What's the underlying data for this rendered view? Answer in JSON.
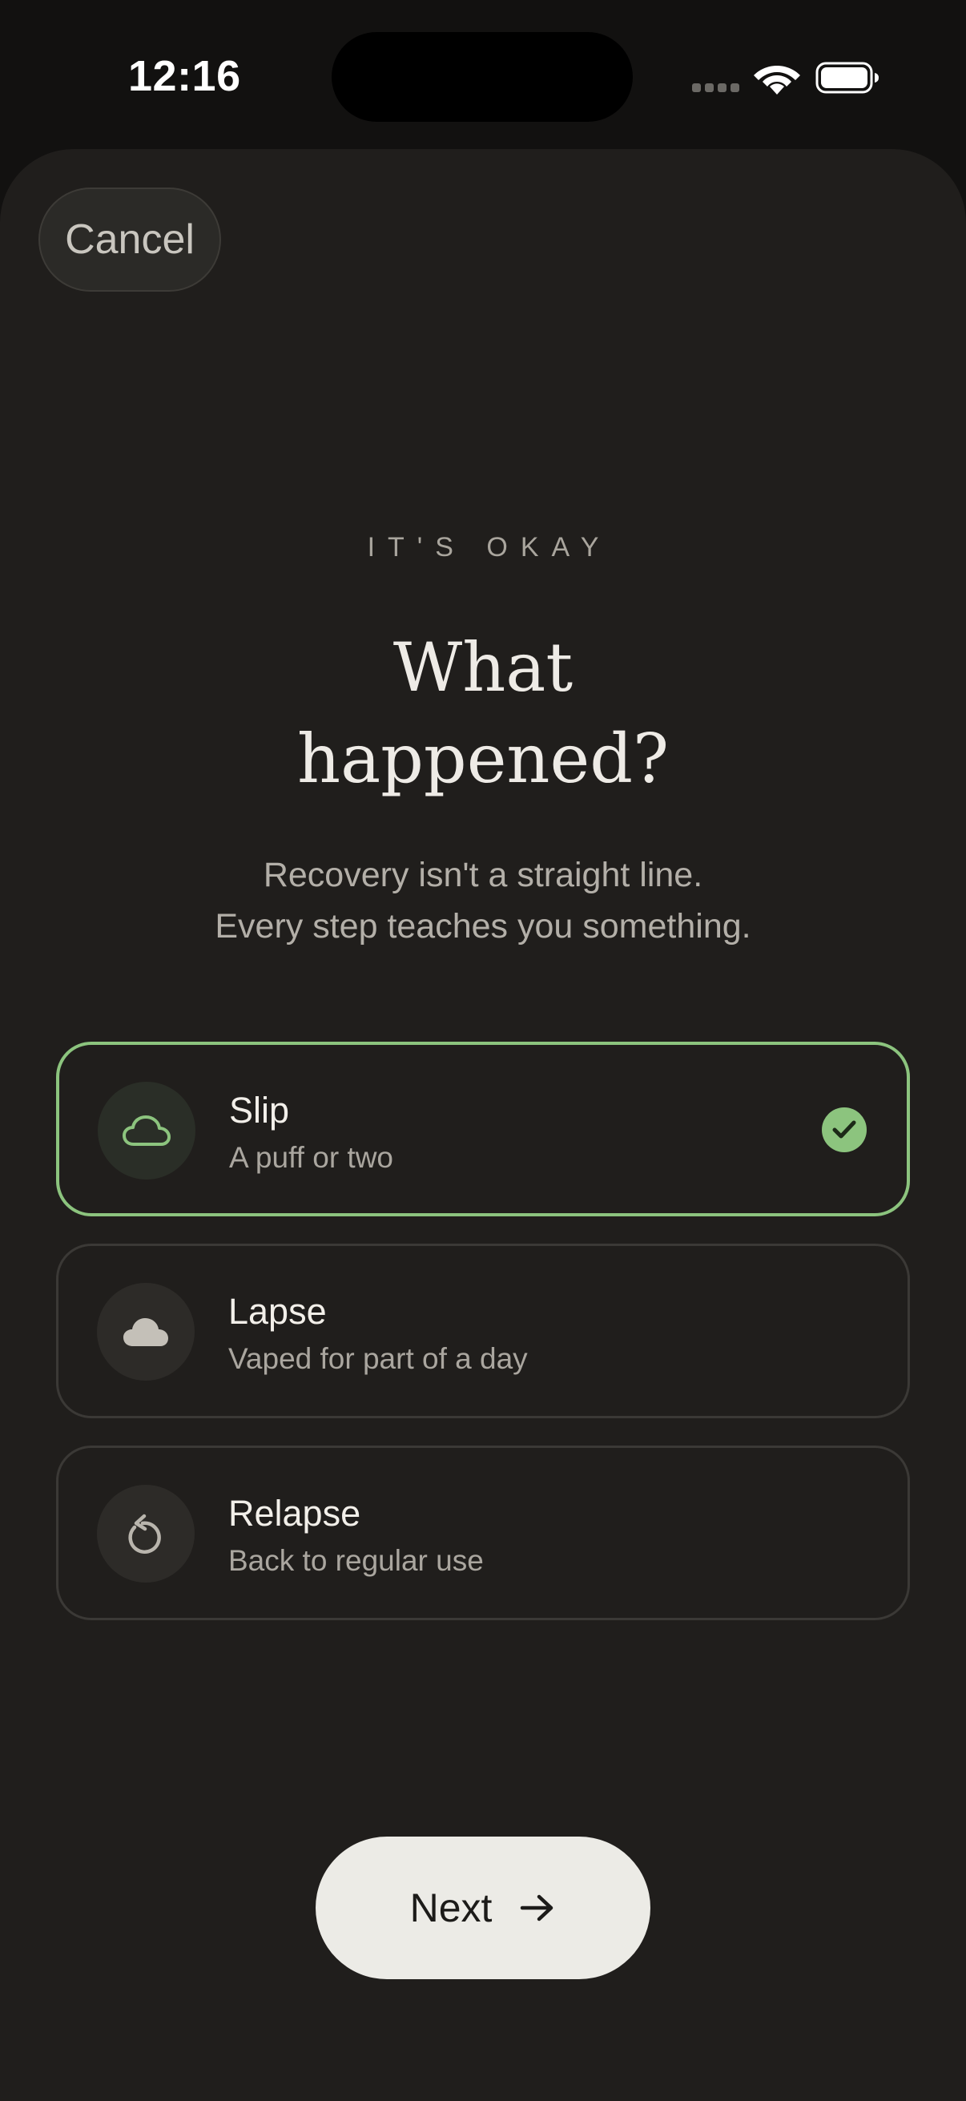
{
  "status_bar": {
    "time": "12:16"
  },
  "header": {
    "cancel_label": "Cancel"
  },
  "content": {
    "eyebrow": "IT'S OKAY",
    "title_line1": "What",
    "title_line2": "happened?",
    "subtitle_line1": "Recovery isn't a straight line.",
    "subtitle_line2": "Every step teaches you something."
  },
  "options": [
    {
      "title": "Slip",
      "subtitle": "A puff or two",
      "icon": "cloud-outline-icon",
      "selected": true
    },
    {
      "title": "Lapse",
      "subtitle": "Vaped for part of a day",
      "icon": "cloud-filled-icon",
      "selected": false
    },
    {
      "title": "Relapse",
      "subtitle": "Back to regular use",
      "icon": "rotate-left-icon",
      "selected": false
    }
  ],
  "footer": {
    "next_label": "Next",
    "next_icon": "arrow-right-icon"
  },
  "colors": {
    "accent": "#8cc47e",
    "background": "#201e1c",
    "button_light": "#ecebe6"
  }
}
